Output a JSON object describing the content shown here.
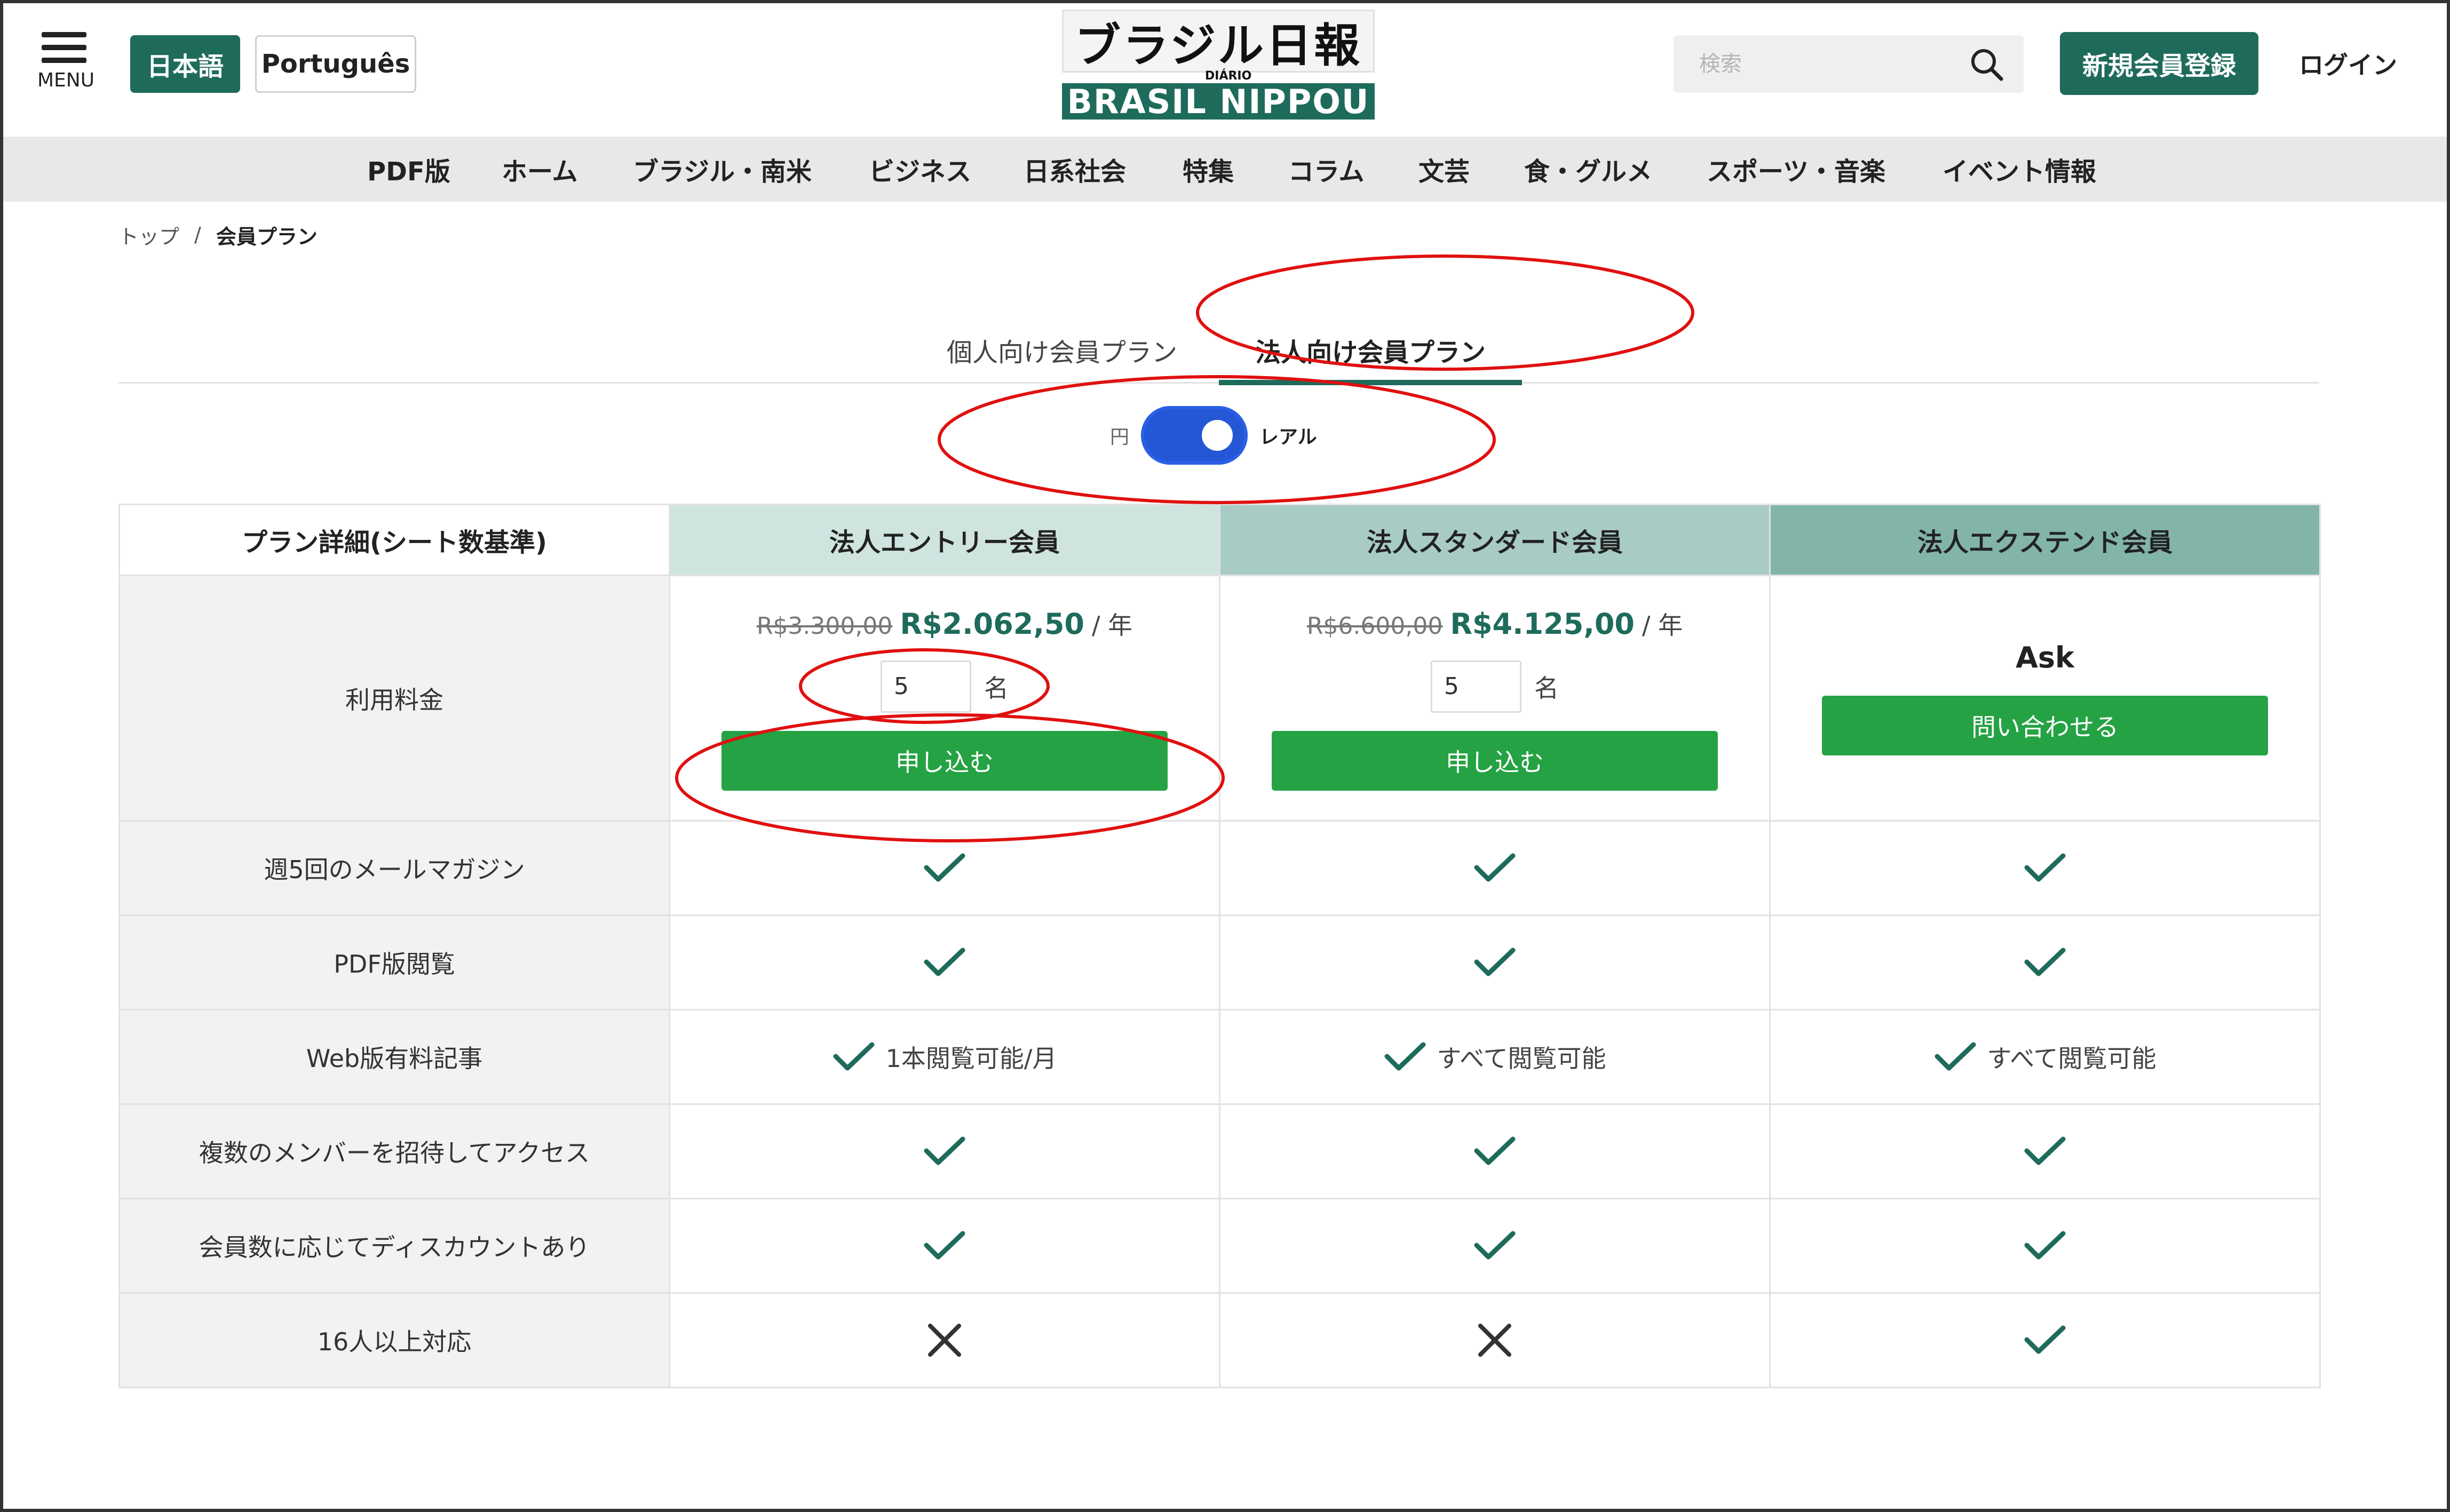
{
  "header": {
    "menu_label": "MENU",
    "lang_ja": "日本語",
    "lang_pt": "Português",
    "logo_jp": "ブラジル日報",
    "logo_diario": "DIÁRIO",
    "logo_en": "BRASIL NIPPOU",
    "search_placeholder": "検索",
    "signup": "新規会員登録",
    "login": "ログイン"
  },
  "nav": [
    "PDF版",
    "ホーム",
    "ブラジル・南米",
    "ビジネス",
    "日系社会",
    "特集",
    "コラム",
    "文芸",
    "食・グルメ",
    "スポーツ・音楽",
    "イベント情報"
  ],
  "breadcrumb": {
    "top": "トップ",
    "sep": "/",
    "current": "会員プラン"
  },
  "tabs": {
    "personal": "個人向け会員プラン",
    "corporate": "法人向け会員プラン"
  },
  "currency_toggle": {
    "left": "円",
    "right": "レアル",
    "selected": "レアル"
  },
  "table": {
    "header_label": "プラン詳細(シート数基準)",
    "plans": [
      {
        "name": "法人エントリー会員",
        "old_price": "R$3.300,00",
        "price": "R$2.062,50",
        "unit": "/ 年",
        "seats": "5",
        "seat_unit": "名",
        "button": "申し込む"
      },
      {
        "name": "法人スタンダード会員",
        "old_price": "R$6.600,00",
        "price": "R$4.125,00",
        "unit": "/ 年",
        "seats": "5",
        "seat_unit": "名",
        "button": "申し込む"
      },
      {
        "name": "法人エクステンド会員",
        "ask": "Ask",
        "button": "問い合わせる"
      }
    ],
    "price_label": "利用料金",
    "features": [
      {
        "label": "週5回のメールマガジン",
        "cells": [
          {
            "mark": "check",
            "text": ""
          },
          {
            "mark": "check",
            "text": ""
          },
          {
            "mark": "check",
            "text": ""
          }
        ]
      },
      {
        "label": "PDF版閲覧",
        "cells": [
          {
            "mark": "check",
            "text": ""
          },
          {
            "mark": "check",
            "text": ""
          },
          {
            "mark": "check",
            "text": ""
          }
        ]
      },
      {
        "label": "Web版有料記事",
        "cells": [
          {
            "mark": "check",
            "text": "1本閲覧可能/月"
          },
          {
            "mark": "check",
            "text": "すべて閲覧可能"
          },
          {
            "mark": "check",
            "text": "すべて閲覧可能"
          }
        ]
      },
      {
        "label": "複数のメンバーを招待してアクセス",
        "cells": [
          {
            "mark": "check",
            "text": ""
          },
          {
            "mark": "check",
            "text": ""
          },
          {
            "mark": "check",
            "text": ""
          }
        ]
      },
      {
        "label": "会員数に応じてディスカウントあり",
        "cells": [
          {
            "mark": "check",
            "text": ""
          },
          {
            "mark": "check",
            "text": ""
          },
          {
            "mark": "check",
            "text": ""
          }
        ]
      },
      {
        "label": "16人以上対応",
        "cells": [
          {
            "mark": "cross",
            "text": ""
          },
          {
            "mark": "cross",
            "text": ""
          },
          {
            "mark": "check",
            "text": ""
          }
        ]
      }
    ]
  },
  "colors": {
    "brand": "#1e6b5c",
    "apply_button": "#25a244",
    "toggle": "#2457d6",
    "annotation": "#e01010",
    "header_entry": "#cfe3df",
    "header_standard": "#a8cbc5",
    "header_extend": "#83b4aa"
  },
  "icons": {
    "check": "check-icon",
    "cross": "cross-icon",
    "search": "search-icon",
    "menu": "hamburger-menu-icon"
  }
}
